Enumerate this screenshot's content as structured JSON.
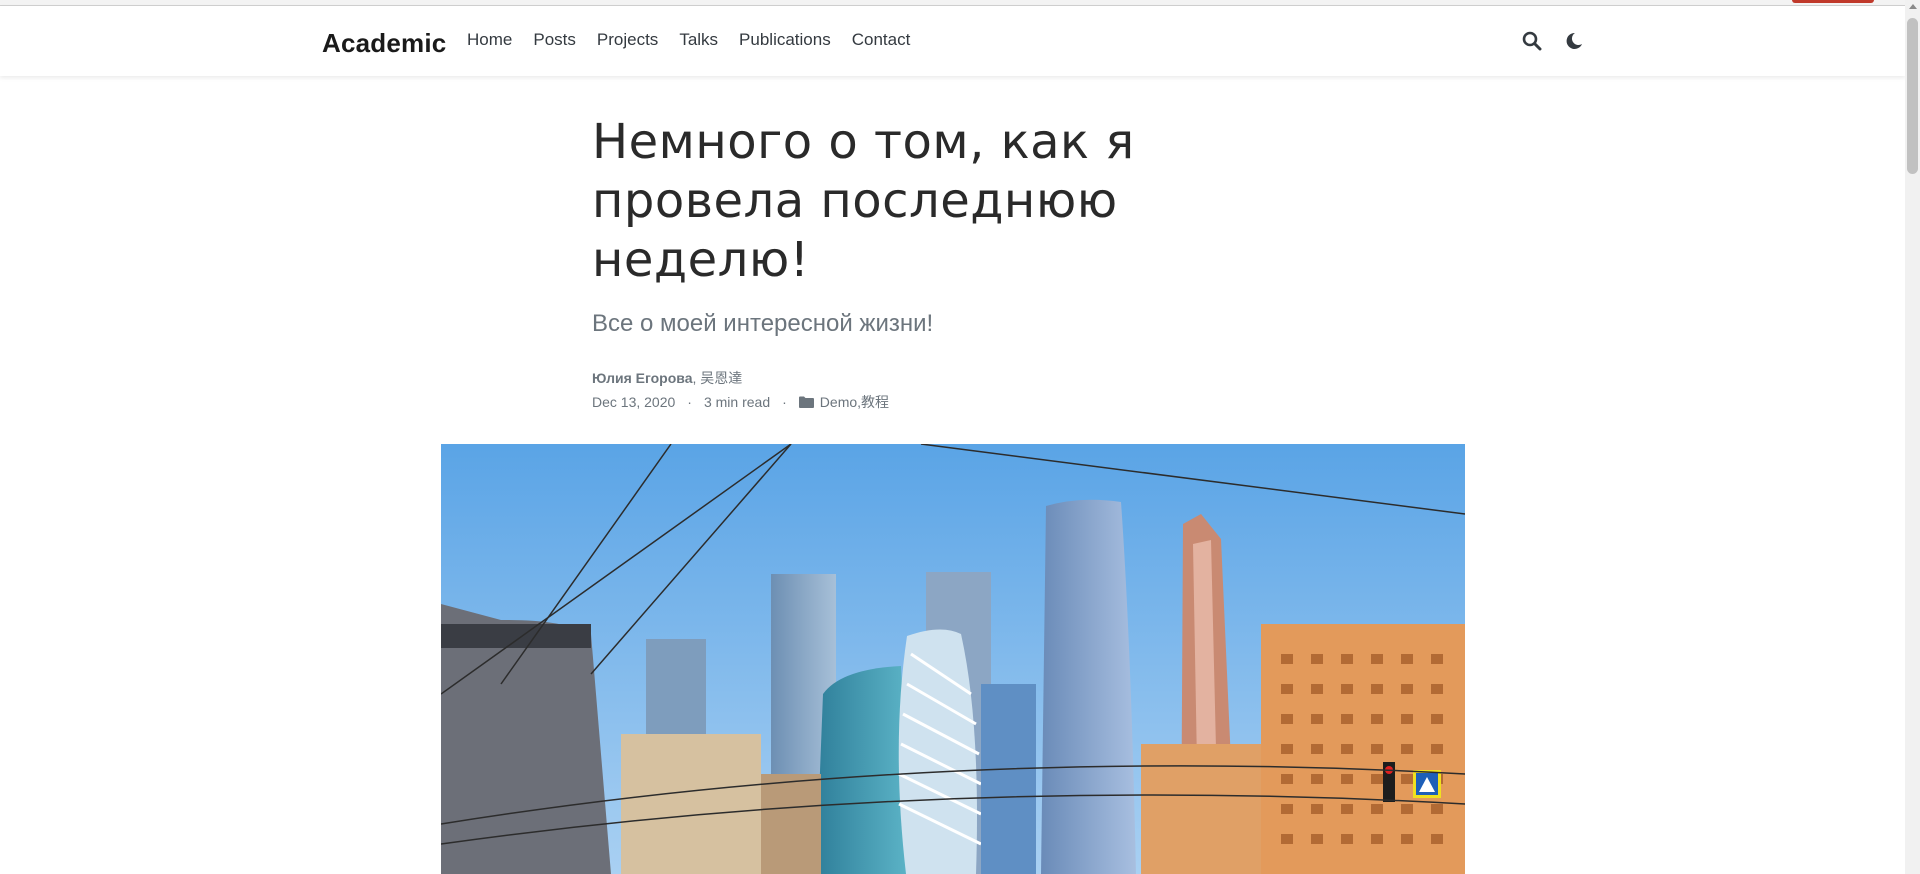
{
  "navbar": {
    "brand": "Academic",
    "links": [
      "Home",
      "Posts",
      "Projects",
      "Talks",
      "Publications",
      "Contact"
    ],
    "icons": [
      "search-icon",
      "moon-icon"
    ]
  },
  "article": {
    "title": "Немного о том, как я провела последнюю неделю!",
    "subtitle": "Все о моей интересной жизни!",
    "author_main": "Юлия Егорова",
    "author_sep": ", ",
    "author_second": "吴恩達",
    "date": "Dec 13, 2020",
    "dot": "·",
    "read_time": "3 min read",
    "category_1": "Demo",
    "category_sep": ", ",
    "category_2": "教程"
  },
  "colors": {
    "text": "#343a40",
    "muted": "#6c757d",
    "accent": "#c0392b"
  }
}
